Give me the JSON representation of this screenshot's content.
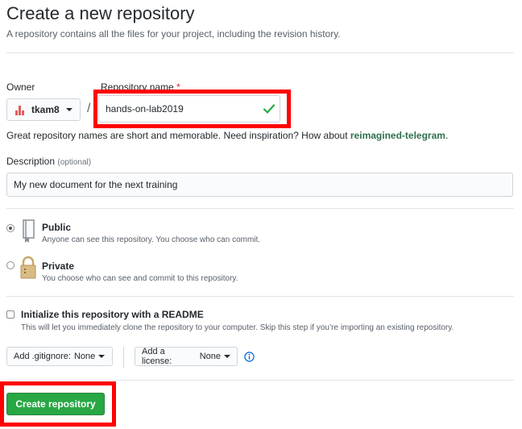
{
  "header": {
    "title": "Create a new repository",
    "subtitle": "A repository contains all the files for your project, including the revision history."
  },
  "owner": {
    "label": "Owner",
    "value": "tkam8"
  },
  "repo": {
    "label": "Repository name",
    "required_mark": "*",
    "value": "hands-on-lab2019",
    "separator": "/"
  },
  "hint": {
    "text": "Great repository names are short and memorable. Need inspiration? How about ",
    "suggestion": "reimagined-telegram",
    "end": "."
  },
  "description": {
    "label": "Description",
    "optional": "(optional)",
    "value": "My new document for the next training"
  },
  "visibility": {
    "public": {
      "label": "Public",
      "desc": "Anyone can see this repository. You choose who can commit.",
      "selected": true
    },
    "private": {
      "label": "Private",
      "desc": "You choose who can see and commit to this repository.",
      "selected": false
    }
  },
  "readme": {
    "label": "Initialize this repository with a README",
    "desc": "This will let you immediately clone the repository to your computer. Skip this step if you’re importing an existing repository."
  },
  "gitignore": {
    "label": "Add .gitignore:",
    "value": "None"
  },
  "license": {
    "label": "Add a license:",
    "value": "None"
  },
  "create_button": "Create repository",
  "colors": {
    "primary": "#28a745",
    "highlight": "#ff0000"
  }
}
